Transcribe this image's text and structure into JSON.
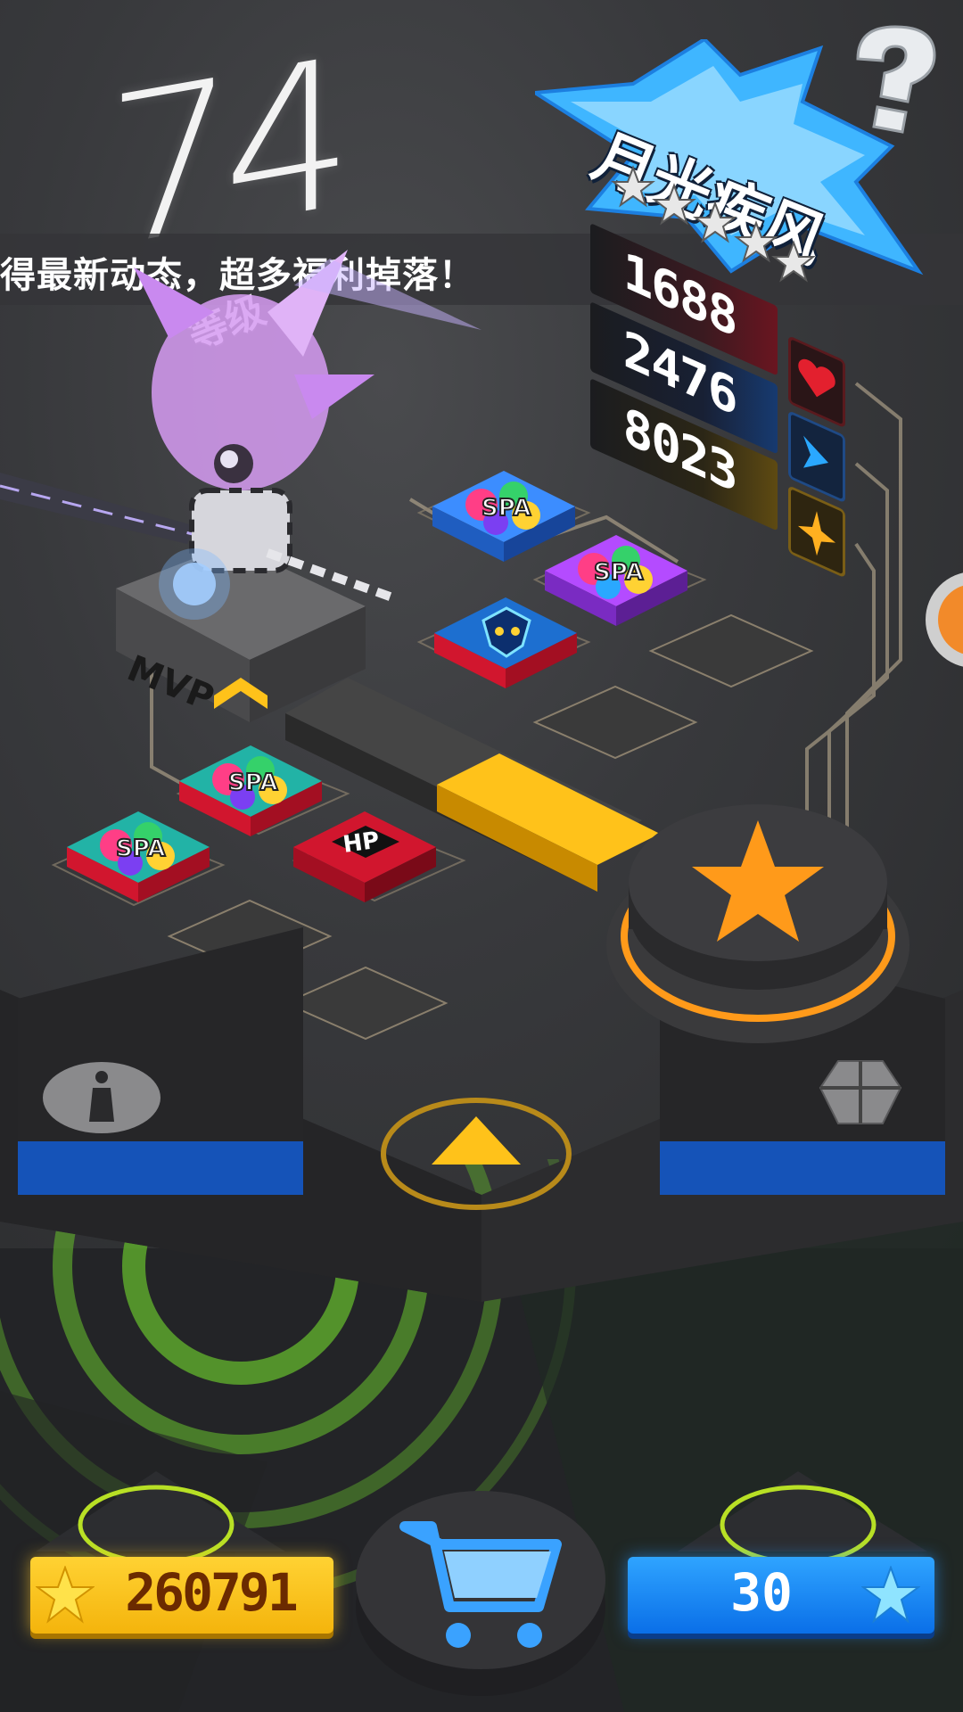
{
  "level": {
    "number": "74",
    "label": "等级"
  },
  "marquee": {
    "text": "得最新动态，超多福利掉落！"
  },
  "character": {
    "name": "月光疾风",
    "stars_filled": 5,
    "stars_total": 5,
    "badge_text": "MVP"
  },
  "stats": {
    "hp": "1688",
    "speed": "2476",
    "power": "8023"
  },
  "tiles": {
    "mod_label": "SPA",
    "hp_label": "HP"
  },
  "currency": {
    "coins": "260791",
    "gems": "30"
  },
  "colors": {
    "accent_yellow": "#ffc21a",
    "accent_orange": "#ff9a1a",
    "accent_blue": "#1f7ff0",
    "hp_red": "#e3202e",
    "speed_blue": "#2aa8ff"
  },
  "icons": {
    "help": "question-mark-icon",
    "info": "info-icon",
    "upgrade": "arrow-up-icon",
    "play": "star-icon",
    "gamepad": "gamepad-icon",
    "shop": "cart-icon"
  }
}
